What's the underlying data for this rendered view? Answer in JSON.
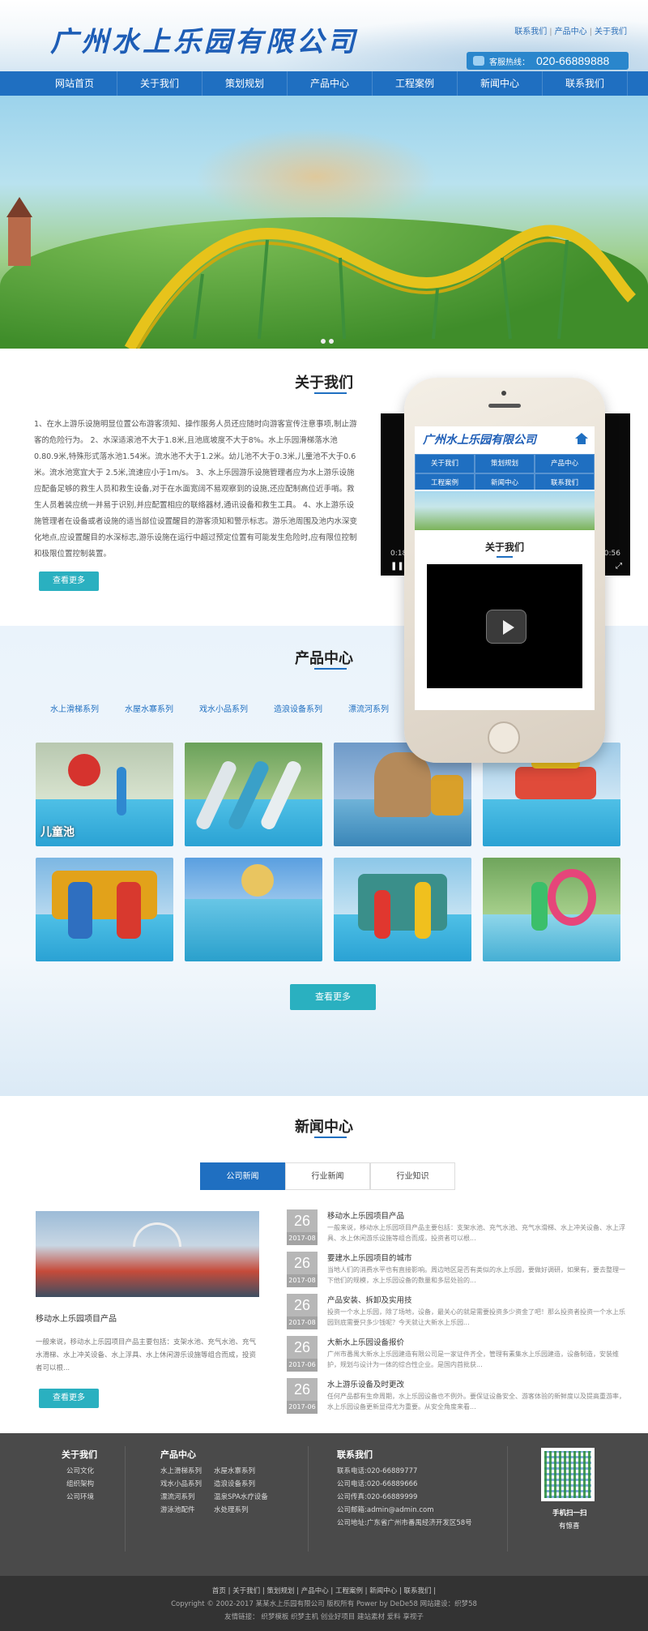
{
  "header": {
    "logo_text": "广州水上乐园有限公司",
    "toplinks": [
      "联系我们",
      "产品中心",
      "关于我们"
    ],
    "hotline_label": "客服热线：",
    "hotline_number": "020-66889888"
  },
  "nav": {
    "items": [
      "网站首页",
      "关于我们",
      "策划规划",
      "产品中心",
      "工程案例",
      "新闻中心",
      "联系我们"
    ]
  },
  "about": {
    "title": "关于我们",
    "text": "1、在水上游乐设施明显位置公布游客须知、操作服务人员还应随时向游客宣传注意事项,制止游客的危险行为。 2、水深适滚池不大于1.8米,且池底坡度不大于8%。水上乐园滑梯落水池0.80.9米,特殊形式落水池1.54米。流水池不大于1.2米。幼儿池不大于0.3米,儿童池不大于0.6米。流水池宽宜大于 2.5米,流速应小于1m/s。 3、水上乐园游乐设施管理者应为水上游乐设施应配备足够的救生人员和救生设备,对于在水面宽阔不易观察到的设施,还应配制高位近手哨。救生人员着装应统一并易于识别,并应配置相应的联络器材,通讯设备和救生工具。 4、水上游乐设施管理者在设备或者设施的适当部位设置醒目的游客须知和警示标志。游乐池周围及池内水深变化地点,应设置醒目的水深标志,游乐设施在运行中超过预定位置有可能发生危险时,应有限位控制和极限位置控制装置。",
    "more_label": "查看更多",
    "video_time_left": "0:18",
    "video_time_right": "0:56"
  },
  "phone": {
    "logo_text": "广州水上乐园有限公司",
    "nav": [
      "关于我们",
      "策划规划",
      "产品中心",
      "工程案例",
      "新闻中心",
      "联系我们"
    ],
    "section_title": "关于我们"
  },
  "products": {
    "title": "产品中心",
    "categories": [
      "水上滑梯系列",
      "水屋水寨系列",
      "戏水小品系列",
      "造浪设备系列",
      "漂流河系列"
    ],
    "thumb_caption": "儿童池",
    "more_label": "查看更多"
  },
  "news": {
    "title": "新闻中心",
    "tabs": [
      "公司新闻",
      "行业新闻",
      "行业知识"
    ],
    "feature": {
      "title": "移动水上乐园项目产品",
      "desc": "一般来说，移动水上乐园项目产品主要包括：支架水池、充气水池、充气水滑梯、水上冲关设备、水上浮具、水上休闲游乐设施等组合而成，投资者可以根...",
      "more_label": "查看更多"
    },
    "items": [
      {
        "day": "26",
        "ym": "2017-08",
        "title": "移动水上乐园项目产品",
        "desc": "一般来说，移动水上乐园项目产品主要包括：支架水池、充气水池、充气水滑梯、水上冲关设备、水上浮具、水上休闲游乐设施等组合而成，投资者可以根..."
      },
      {
        "day": "26",
        "ym": "2017-08",
        "title": "要建水上乐园项目的城市",
        "desc": "当地人们的消费水平也有直接影响。周边地区是否有类似的水上乐园，要做好调研，如果有，要去整理一下他们的规模，水上乐园设备的数量和多层处验的..."
      },
      {
        "day": "26",
        "ym": "2017-08",
        "title": "产品安装、拆卸及实用技",
        "desc": "投资一个水上乐园，除了场地，设备，最关心的就是需要投资多少资金了吧！那么投资者投资一个水上乐园到底需要只多少钱呢？今天就让大新水上乐园..."
      },
      {
        "day": "26",
        "ym": "2017-06",
        "title": "大新水上乐园设备报价",
        "desc": "广州市番禺大新水上乐园建造有限公司是一家证件齐全，管理有素集水上乐园建造，设备制造，安装维护，规划与设计为一体的综合性企业。是国内首批获..."
      },
      {
        "day": "26",
        "ym": "2017-06",
        "title": "水上游乐设备及时更改",
        "desc": "任何产品都有生命周期，水上乐园设备也不例外。要保证设备安全、游客体验的新鲜度以及提高重游率，水上乐园设备更新显得尤为重要。从安全角度来看..."
      }
    ]
  },
  "footer": {
    "col1": {
      "title": "关于我们",
      "links": [
        "公司文化",
        "组织架构",
        "公司环境"
      ]
    },
    "col2": {
      "title": "产品中心",
      "links_left": [
        "水上滑梯系列",
        "戏水小品系列",
        "漂流河系列",
        "游泳池配件"
      ],
      "links_right": [
        "水屋水寨系列",
        "造浪设备系列",
        "温泉SPA水疗设备",
        "水处理系列"
      ]
    },
    "col3": {
      "title": "联系我们",
      "lines": [
        "联系电话:020-66889777",
        "公司电话:020-66889666",
        "公司传真:020-66889999",
        "公司邮箱:admin@admin.com",
        "公司地址:广东省广州市番禺经济开发区58号"
      ]
    },
    "qr_label": "手机扫一扫",
    "qr_sub": "有惊喜",
    "bottom_links": "首页 | 关于我们 | 策划规划 | 产品中心 | 工程案例 | 新闻中心 | 联系我们 |",
    "copyright": "Copyright © 2002-2017 某某水上乐园有限公司 版权所有  Power by DeDe58 网站建设：织梦58",
    "friend_links": "友情链接：  织梦模板    织梦主机    创业好项目    建站素材    爱料    享视子"
  }
}
